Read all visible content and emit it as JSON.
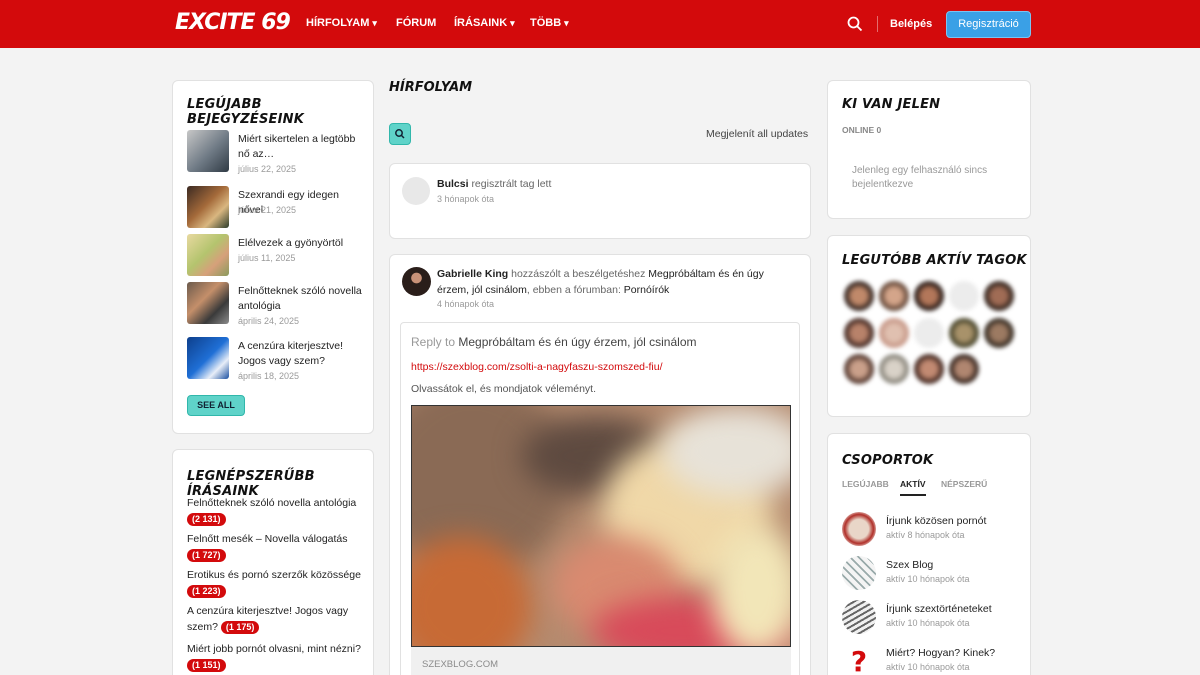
{
  "header": {
    "logo": "EXCITE 69",
    "nav": [
      {
        "label": "HÍRFOLYAM",
        "chevron": true
      },
      {
        "label": "FÓRUM",
        "chevron": false
      },
      {
        "label": "ÍRÁSAINK",
        "chevron": true
      },
      {
        "label": "TÖBB",
        "chevron": true
      }
    ],
    "login": "Belépés",
    "register": "Regisztráció"
  },
  "latest": {
    "title": "Legújabb bejegyzéseink",
    "items": [
      {
        "title": "Miért sikertelen a legtöbb nő az…",
        "date": "július 22, 2025"
      },
      {
        "title": "Szexrandi egy idegen nővel",
        "date": "július 21, 2025"
      },
      {
        "title": "Elélvezek a gyönyörtöl",
        "date": "július 11, 2025"
      },
      {
        "title": "Felnőtteknek szóló novella antológia",
        "date": "április 24, 2025"
      },
      {
        "title": "A cenzúra kiterjesztve! Jogos vagy szem?",
        "date": "április 18, 2025"
      }
    ],
    "see_all": "SEE ALL"
  },
  "popular": {
    "title": "Legnépszerűbb írásaink",
    "items": [
      {
        "title": "Felnőtteknek szóló novella antológia",
        "count": "2 131"
      },
      {
        "title": "Felnőtt mesék – Novella válogatás",
        "count": "1 727"
      },
      {
        "title": "Erotikus és pornó szerzők közössége",
        "count": "1 223"
      },
      {
        "title": "A cenzúra kiterjesztve! Jogos vagy szem?",
        "count": "1 175"
      },
      {
        "title": "Miért jobb pornót olvasni, mint nézni?",
        "count": "1 151"
      }
    ]
  },
  "feed": {
    "title": "Hírfolyam",
    "showing": "Megjelenít all updates",
    "activity1": {
      "user": "Bulcsi",
      "action": "regisztrált tag lett",
      "time": "3 hónapok óta"
    },
    "activity2": {
      "user": "Gabrielle King",
      "action_pre": "hozzászólt a beszélgetéshez",
      "topic": "Megpróbáltam és én úgy érzem, jól csinálom",
      "action_mid": ", ebben a fórumban:",
      "forum": "Pornóírók",
      "time": "4 hónapok óta",
      "reply_prefix": "Reply to",
      "reply_topic": "Megpróbáltam és én úgy érzem, jól csinálom",
      "link": "https://szexblog.com/zsolti-a-nagyfaszu-szomszed-fiu/",
      "body": "Olvassátok el, és mondjatok véleményt.",
      "domain": "SZEXBLOG.COM"
    }
  },
  "online": {
    "title": "Ki van jelen",
    "label": "ONLINE 0",
    "message": "Jelenleg egy felhasználó sincs bejelentkezve"
  },
  "active": {
    "title": "Legutóbb aktív tagok"
  },
  "groups": {
    "title": "Csoportok",
    "tabs": [
      "LEGÚJABB",
      "AKTÍV",
      "NÉPSZERŰ"
    ],
    "active_tab": "AKTÍV",
    "items": [
      {
        "name": "Írjunk közösen pornót",
        "time": "aktív 8 hónapok óta"
      },
      {
        "name": "Szex Blog",
        "time": "aktív 10 hónapok óta"
      },
      {
        "name": "Írjunk szextörténeteket",
        "time": "aktív 10 hónapok óta"
      },
      {
        "name": "Miért? Hogyan? Kinek?",
        "time": "aktív 10 hónapok óta"
      }
    ]
  },
  "colors": {
    "brand": "#d30a0c",
    "accent": "#5fd3c9",
    "register": "#3aa0e6"
  }
}
